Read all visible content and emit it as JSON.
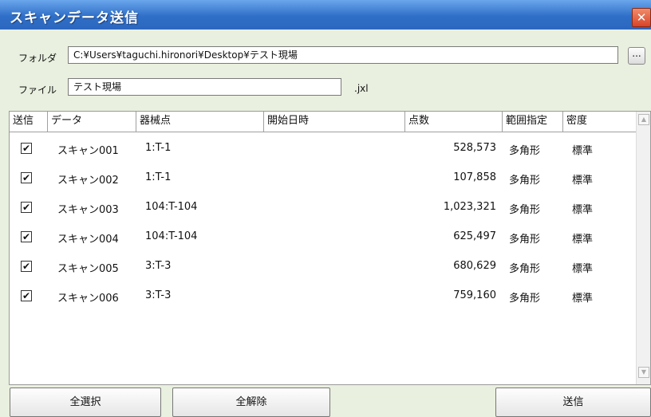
{
  "window": {
    "title": "スキャンデータ送信",
    "close_label": "✕"
  },
  "folder": {
    "label": "フォルダ",
    "value": "C:¥Users¥taguchi.hironori¥Desktop¥テスト現場",
    "browse_label": "..."
  },
  "file": {
    "label": "ファイル",
    "value": "テスト現場",
    "extension": ".jxl"
  },
  "table": {
    "headers": [
      "送信",
      "データ",
      "器械点",
      "開始日時",
      "点数",
      "範囲指定",
      "密度"
    ],
    "rows": [
      {
        "checked": true,
        "check": "✔",
        "data": "スキャン001",
        "station": "1:T-1",
        "start": "",
        "points": "528,573",
        "range": "多角形",
        "density": "標準"
      },
      {
        "checked": true,
        "check": "✔",
        "data": "スキャン002",
        "station": "1:T-1",
        "start": "",
        "points": "107,858",
        "range": "多角形",
        "density": "標準"
      },
      {
        "checked": true,
        "check": "✔",
        "data": "スキャン003",
        "station": "104:T-104",
        "start": "",
        "points": "1,023,321",
        "range": "多角形",
        "density": "標準"
      },
      {
        "checked": true,
        "check": "✔",
        "data": "スキャン004",
        "station": "104:T-104",
        "start": "",
        "points": "625,497",
        "range": "多角形",
        "density": "標準"
      },
      {
        "checked": true,
        "check": "✔",
        "data": "スキャン005",
        "station": "3:T-3",
        "start": "",
        "points": "680,629",
        "range": "多角形",
        "density": "標準"
      },
      {
        "checked": true,
        "check": "✔",
        "data": "スキャン006",
        "station": "3:T-3",
        "start": "",
        "points": "759,160",
        "range": "多角形",
        "density": "標準"
      }
    ]
  },
  "buttons": {
    "select_all": "全選択",
    "deselect_all": "全解除",
    "send": "送信"
  }
}
